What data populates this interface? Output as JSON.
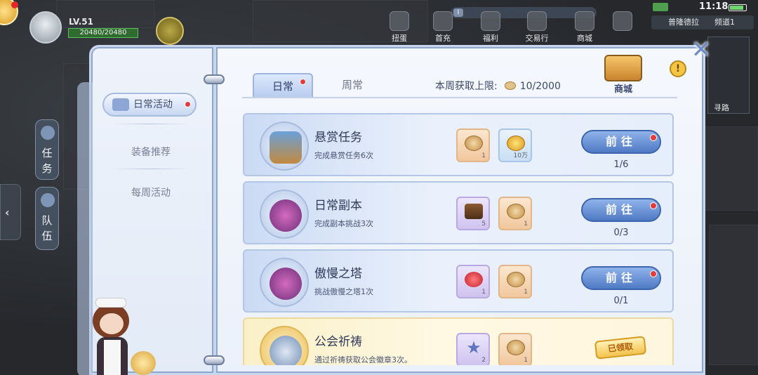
{
  "hud": {
    "level": "LV.51",
    "hp": "20480/20480",
    "time": "11:18",
    "location": "普隆德拉",
    "channel": "频道1",
    "menu": [
      {
        "label": "扭蛋",
        "icon": "capsule-icon"
      },
      {
        "label": "首充",
        "icon": "gift-icon"
      },
      {
        "label": "福利",
        "icon": "welfare-icon"
      },
      {
        "label": "交易行",
        "icon": "trade-icon"
      },
      {
        "label": "商城",
        "icon": "shop-icon"
      }
    ],
    "route_label": "寻路",
    "side_tabs": [
      {
        "label": "任务",
        "icon": "quest-icon"
      },
      {
        "label": "队伍",
        "icon": "flag-icon"
      }
    ]
  },
  "nav": {
    "active": "日常活动",
    "items": [
      "装备推荐",
      "每周活动"
    ]
  },
  "tabs": {
    "daily": "日常",
    "weekly": "周常"
  },
  "limit": {
    "label": "本周获取上限:",
    "value": "10/2000"
  },
  "shop": {
    "label": "商城"
  },
  "quests": [
    {
      "title": "悬赏任务",
      "desc": "完成悬赏任务6次",
      "emblem": "notice-board-icon",
      "rewards": [
        {
          "icon": "coin-icon",
          "qty": "1"
        },
        {
          "icon": "gold-coin-icon",
          "qty": "10万"
        }
      ],
      "button": "前往",
      "progress": "1/6",
      "claimed": false
    },
    {
      "title": "日常副本",
      "desc": "完成副本挑战3次",
      "emblem": "demon-mask-icon",
      "rewards": [
        {
          "icon": "chest-icon",
          "qty": "5"
        },
        {
          "icon": "coin-icon",
          "qty": "1"
        }
      ],
      "button": "前往",
      "progress": "0/3",
      "claimed": false
    },
    {
      "title": "傲慢之塔",
      "desc": "挑战傲慢之塔1次",
      "emblem": "demon-mask-icon",
      "rewards": [
        {
          "icon": "potion-icon",
          "qty": "1"
        },
        {
          "icon": "coin-icon",
          "qty": "1"
        }
      ],
      "button": "前往",
      "progress": "0/1",
      "claimed": false
    },
    {
      "title": "公会祈祷",
      "desc": "通过祈祷获取公会徽章3次。",
      "emblem": "guild-emblem-icon",
      "rewards": [
        {
          "icon": "star-badge-icon",
          "qty": "2"
        },
        {
          "icon": "coin-icon",
          "qty": "1"
        }
      ],
      "status": "已领取",
      "claimed": true
    }
  ]
}
